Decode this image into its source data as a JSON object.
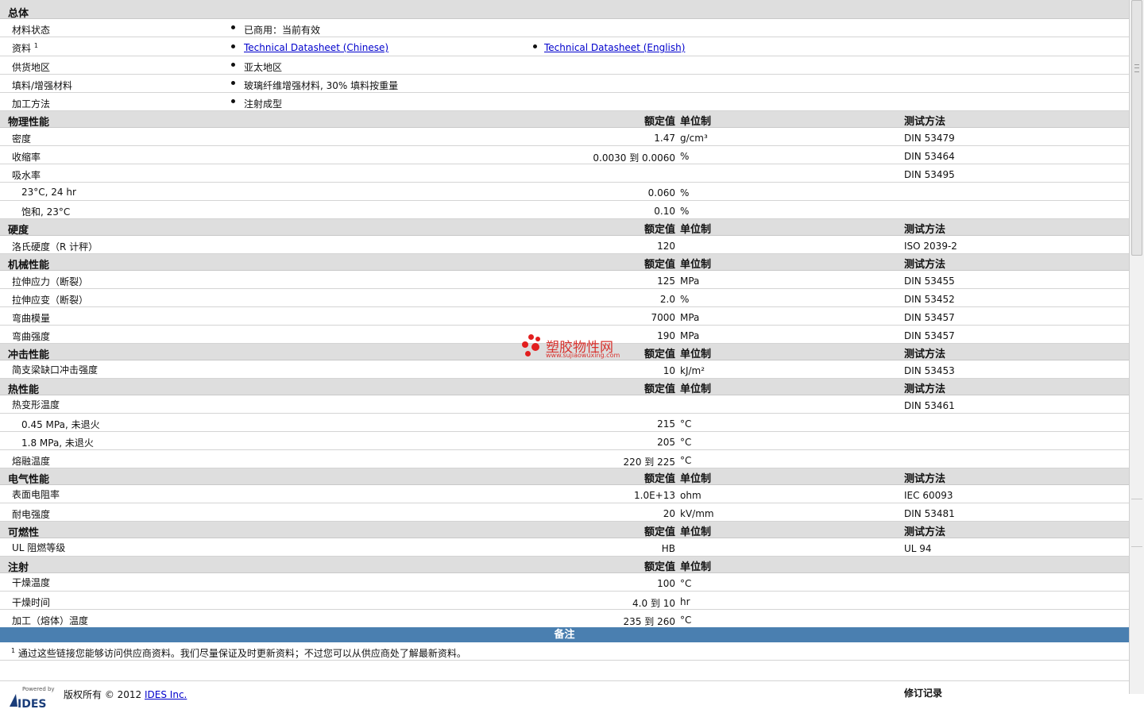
{
  "headers": {
    "nominal": "额定值",
    "unit": "单位制",
    "test": "测试方法"
  },
  "general": {
    "title": "总体",
    "status_label": "材料状态",
    "status_value": "已商用：当前有效",
    "docs_label": "资料",
    "docs_sup": "1",
    "doc_link_cn": "Technical Datasheet (Chinese)",
    "doc_link_en": "Technical Datasheet (English)",
    "region_label": "供货地区",
    "region_value": "亚太地区",
    "filler_label": "填料/增强材料",
    "filler_value": "玻璃纤维增强材料, 30% 填料按重量",
    "process_label": "加工方法",
    "process_value": "注射成型"
  },
  "physical": {
    "title": "物理性能",
    "rows": [
      {
        "label": "密度",
        "nominal": "1.47",
        "unit": "g/cm³",
        "test": "DIN 53479"
      },
      {
        "label": "收缩率",
        "nominal": "0.0030 到  0.0060",
        "unit": "%",
        "test": "DIN 53464"
      },
      {
        "label": "吸水率",
        "nominal": "",
        "unit": "",
        "test": "DIN 53495"
      },
      {
        "label": "23°C, 24 hr",
        "nominal": "0.060",
        "unit": "%",
        "test": ""
      },
      {
        "label": "饱和, 23°C",
        "nominal": "0.10",
        "unit": "%",
        "test": ""
      }
    ]
  },
  "hardness": {
    "title": "硬度",
    "rows": [
      {
        "label": "洛氏硬度（R 计秤）",
        "nominal": "120",
        "unit": "",
        "test": "ISO 2039-2"
      }
    ]
  },
  "mechanical": {
    "title": "机械性能",
    "rows": [
      {
        "label": "拉伸应力（断裂）",
        "nominal": "125",
        "unit": "MPa",
        "test": "DIN 53455"
      },
      {
        "label": "拉伸应变（断裂）",
        "nominal": "2.0",
        "unit": "%",
        "test": "DIN 53452"
      },
      {
        "label": "弯曲模量",
        "nominal": "7000",
        "unit": "MPa",
        "test": "DIN 53457"
      },
      {
        "label": "弯曲强度",
        "nominal": "190",
        "unit": "MPa",
        "test": "DIN 53457"
      }
    ]
  },
  "impact": {
    "title": "冲击性能",
    "rows": [
      {
        "label": "简支梁缺口冲击强度",
        "nominal": "10",
        "unit": "kJ/m²",
        "test": "DIN 53453"
      }
    ]
  },
  "thermal": {
    "title": "热性能",
    "rows": [
      {
        "label": "热变形温度",
        "nominal": "",
        "unit": "",
        "test": "DIN 53461"
      },
      {
        "label": "0.45 MPa, 未退火",
        "nominal": "215",
        "unit": "°C",
        "test": ""
      },
      {
        "label": "1.8 MPa, 未退火",
        "nominal": "205",
        "unit": "°C",
        "test": ""
      },
      {
        "label": "熔融温度",
        "nominal": "220 到  225",
        "unit": "°C",
        "test": ""
      }
    ]
  },
  "electrical": {
    "title": "电气性能",
    "rows": [
      {
        "label": "表面电阻率",
        "nominal": "1.0E+13",
        "unit": "ohm",
        "test": "IEC 60093"
      },
      {
        "label": "耐电强度",
        "nominal": "20",
        "unit": "kV/mm",
        "test": "DIN 53481"
      }
    ]
  },
  "flammability": {
    "title": "可燃性",
    "rows": [
      {
        "label": "UL 阻燃等级",
        "nominal": "HB",
        "unit": "",
        "test": "UL 94"
      }
    ]
  },
  "injection": {
    "title": "注射",
    "rows": [
      {
        "label": "干燥温度",
        "nominal": "100",
        "unit": "°C",
        "test": ""
      },
      {
        "label": "干燥时间",
        "nominal": "4.0 到  10",
        "unit": "hr",
        "test": ""
      },
      {
        "label": "加工（熔体）温度",
        "nominal": "235 到  260",
        "unit": "°C",
        "test": ""
      }
    ]
  },
  "notes": {
    "title": "备注",
    "sup": "1",
    "text": "通过这些链接您能够访问供应商资料。我们尽量保证及时更新资料；不过您可以从供应商处了解最新资料。"
  },
  "footer": {
    "powered_by": "Powered by",
    "logo_text": "IDES",
    "copyright": "版权所有 © 2012",
    "company_link": "IDES Inc.",
    "revision_label": "修订记录"
  },
  "watermark": {
    "title": "塑胶物性网",
    "url": "www.sujiaowuxing.com"
  },
  "colors": {
    "section_bg": "#dedede",
    "notes_bar": "#4a7fb0",
    "link": "#0000cc",
    "watermark": "#d8322e"
  }
}
